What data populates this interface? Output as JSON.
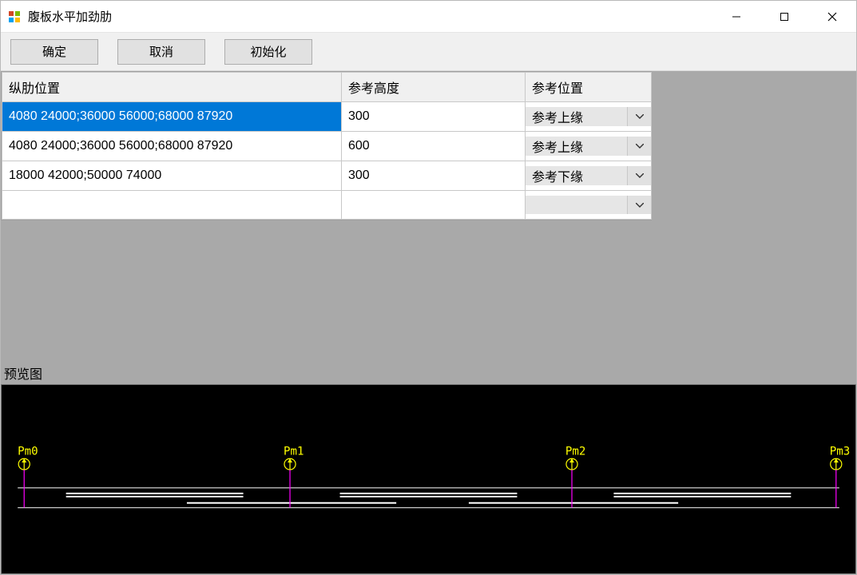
{
  "window": {
    "title": "腹板水平加劲肋"
  },
  "toolbar": {
    "ok_label": "确定",
    "cancel_label": "取消",
    "init_label": "初始化"
  },
  "table": {
    "headers": {
      "position": "纵肋位置",
      "height": "参考高度",
      "reference": "参考位置"
    },
    "rows": [
      {
        "position": "4080 24000;36000 56000;68000 87920",
        "height": "300",
        "reference": "参考上缘",
        "selected": true
      },
      {
        "position": "4080 24000;36000 56000;68000 87920",
        "height": "600",
        "reference": "参考上缘",
        "selected": false
      },
      {
        "position": "18000 42000;50000 74000",
        "height": "300",
        "reference": "参考下缘",
        "selected": false
      },
      {
        "position": "",
        "height": "",
        "reference": "",
        "selected": false
      }
    ]
  },
  "preview": {
    "label": "预览图",
    "markers": [
      "Pm0",
      "Pm1",
      "Pm2",
      "Pm3"
    ]
  }
}
